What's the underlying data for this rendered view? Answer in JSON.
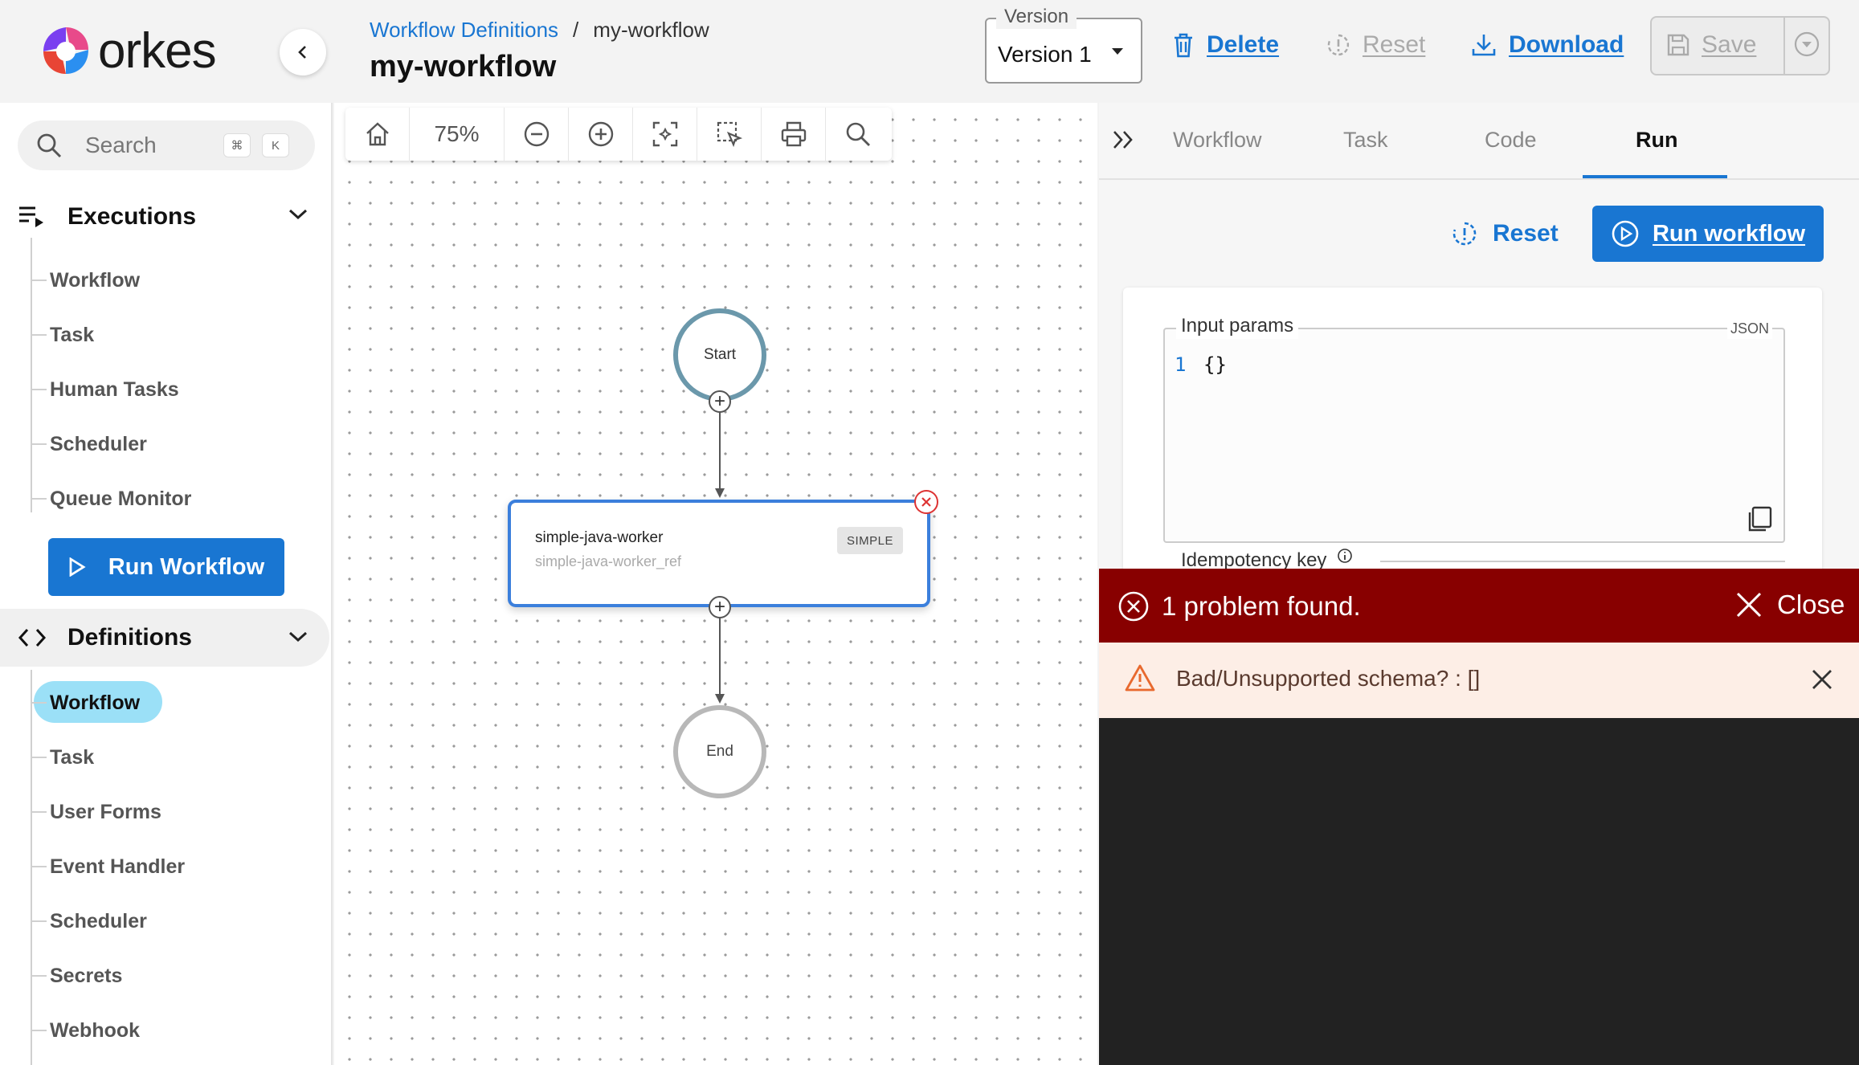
{
  "app": {
    "logo_text": "orkes",
    "brand_colors": {
      "primary": "#1976d2",
      "error": "#880000",
      "accent_node": "#3b7fdc"
    }
  },
  "header": {
    "breadcrumb": {
      "parent": "Workflow Definitions",
      "separator": "/",
      "current": "my-workflow"
    },
    "title": "my-workflow",
    "version": {
      "label": "Version",
      "value": "Version 1"
    },
    "actions": {
      "delete": "Delete",
      "reset": "Reset",
      "download": "Download",
      "save": "Save"
    },
    "icons": {
      "collapse": "chevron-left-icon",
      "delete": "trash-icon",
      "reset": "reset-icon",
      "download": "download-icon",
      "save": "floppy-icon",
      "dropdown": "chevron-down-circle-icon"
    }
  },
  "sidebar": {
    "search": {
      "placeholder": "Search",
      "shortcut_keys": [
        "⌘",
        "K"
      ]
    },
    "executions": {
      "label": "Executions",
      "items": [
        "Workflow",
        "Task",
        "Human Tasks",
        "Scheduler",
        "Queue Monitor"
      ]
    },
    "run_workflow_label": "Run Workflow",
    "definitions": {
      "label": "Definitions",
      "active_item": "Workflow",
      "items": [
        "Workflow",
        "Task",
        "User Forms",
        "Event Handler",
        "Scheduler",
        "Secrets",
        "Webhook"
      ]
    }
  },
  "canvas": {
    "toolbar": {
      "zoom": "75%",
      "tools": [
        "home-icon",
        "zoom-out-icon",
        "zoom-in-icon",
        "fit-view-icon",
        "select-icon",
        "print-icon",
        "search-icon"
      ]
    },
    "nodes": {
      "start": "Start",
      "end": "End",
      "task": {
        "name": "simple-java-worker",
        "ref": "simple-java-worker_ref",
        "type": "SIMPLE"
      }
    }
  },
  "panel": {
    "tabs": [
      "Workflow",
      "Task",
      "Code",
      "Run"
    ],
    "active_tab": "Run",
    "reset_label": "Reset",
    "run_label": "Run workflow",
    "input_params": {
      "label": "Input params",
      "format": "JSON",
      "line_no": "1",
      "content": "{}"
    },
    "idempotency_label": "Idempotency key"
  },
  "error": {
    "summary": "1 problem found.",
    "close_label": "Close",
    "problems": [
      "Bad/Unsupported schema? : []"
    ]
  }
}
